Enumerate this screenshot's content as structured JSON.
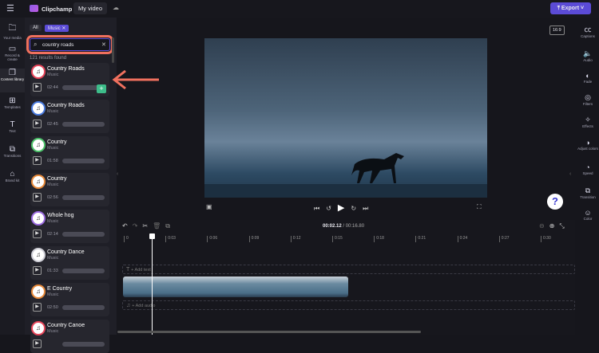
{
  "topbar": {
    "app_name": "Clipchamp",
    "project_name": "My video",
    "export_label": "Export",
    "accent": "#5b4bd6"
  },
  "leftnav": [
    {
      "label": "Your media",
      "icon": "folder-icon"
    },
    {
      "label": "Record & create",
      "icon": "camera-icon"
    },
    {
      "label": "Content library",
      "icon": "library-icon"
    },
    {
      "label": "Templates",
      "icon": "grid-icon"
    },
    {
      "label": "Text",
      "icon": "text-icon"
    },
    {
      "label": "Transitions",
      "icon": "transitions-icon"
    },
    {
      "label": "Brand kit",
      "icon": "brand-icon"
    }
  ],
  "panel": {
    "filter_all": "All",
    "filter_music": "Music",
    "search_value": "country roads",
    "results": "121 results found",
    "items": [
      {
        "title": "Country Roads",
        "type": "Music",
        "duration": "02:44",
        "color": "#e8455a"
      },
      {
        "title": "Country Roads",
        "type": "Music",
        "duration": "02:45",
        "color": "#4a7be0"
      },
      {
        "title": "Country",
        "type": "Music",
        "duration": "01:58",
        "color": "#4cc36a"
      },
      {
        "title": "Country",
        "type": "Music",
        "duration": "02:56",
        "color": "#e88a3a"
      },
      {
        "title": "Whole hog",
        "type": "Music",
        "duration": "02:14",
        "color": "#9b6be0"
      },
      {
        "title": "Country Dance",
        "type": "Music",
        "duration": "01:33",
        "color": "#d0d0d8"
      },
      {
        "title": "E Country",
        "type": "Music",
        "duration": "02:50",
        "color": "#e88a3a"
      },
      {
        "title": "Country Canoe",
        "type": "Music",
        "duration": "",
        "color": "#e8455a"
      }
    ]
  },
  "preview": {
    "aspect": "16:9",
    "help": "?"
  },
  "rail": [
    {
      "label": "Captions",
      "icon": "cc-icon"
    },
    {
      "label": "Audio",
      "icon": "speaker-icon"
    },
    {
      "label": "Fade",
      "icon": "fade-icon"
    },
    {
      "label": "Filters",
      "icon": "filters-icon"
    },
    {
      "label": "Effects",
      "icon": "wand-icon"
    },
    {
      "label": "Adjust colors",
      "icon": "contrast-icon"
    },
    {
      "label": "Speed",
      "icon": "speed-icon"
    },
    {
      "label": "Transition",
      "icon": "transition-icon"
    },
    {
      "label": "Color",
      "icon": "palette-icon"
    }
  ],
  "timeline": {
    "current": "00:02.12",
    "total": "/ 00:16.80",
    "ticks": [
      "0",
      "0:03",
      "0:06",
      "0:09",
      "0:12",
      "0:15",
      "0:18",
      "0:21",
      "0:24",
      "0:27",
      "0:30"
    ],
    "add_text": "+ Add text",
    "add_audio": "+ Add audio"
  }
}
